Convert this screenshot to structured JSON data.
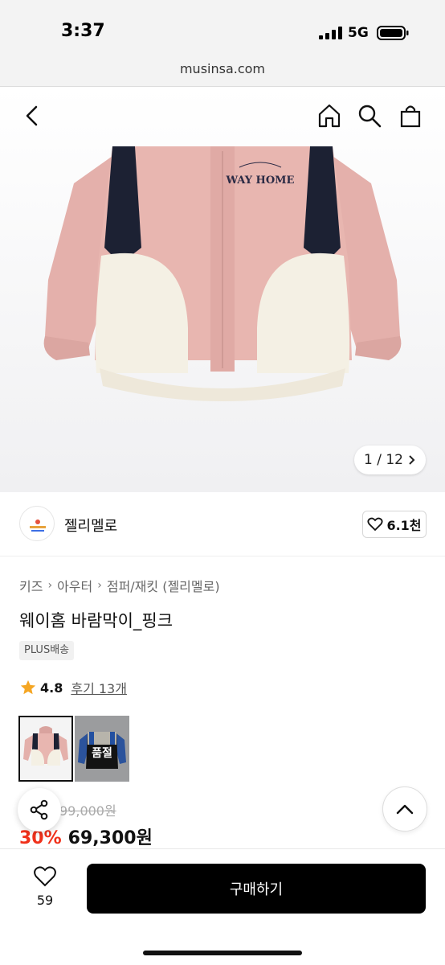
{
  "status_bar": {
    "time": "3:37",
    "network": "5G"
  },
  "browser": {
    "url": "musinsa.com"
  },
  "header_icons": [
    "back-icon",
    "home-icon",
    "search-icon",
    "bag-icon"
  ],
  "gallery": {
    "counter": "1 / 12",
    "jacket_text": "WAY HOME",
    "current_image": 1,
    "total_images": 12
  },
  "brand": {
    "name": "젤리멜로",
    "likes": "6.1천"
  },
  "breadcrumb": [
    "키즈",
    "아우터",
    "점퍼/재킷 (젤리멜로)"
  ],
  "product": {
    "title": "웨이홈 바람막이_핑크",
    "tag": "PLUS배송",
    "rating": "4.8",
    "reviews": "후기 13개",
    "original_price": "99,000원",
    "discount": "30%",
    "price": "69,300원"
  },
  "thumbnails": [
    {
      "selected": true,
      "label": ""
    },
    {
      "selected": false,
      "label": "품절"
    }
  ],
  "bottom_bar": {
    "like_count": "59",
    "buy_label": "구매하기"
  },
  "colors": {
    "accent_discount": "#f0311b",
    "star": "#f5a623",
    "button": "#000000",
    "jacket_pink": "#e6b2ad"
  }
}
